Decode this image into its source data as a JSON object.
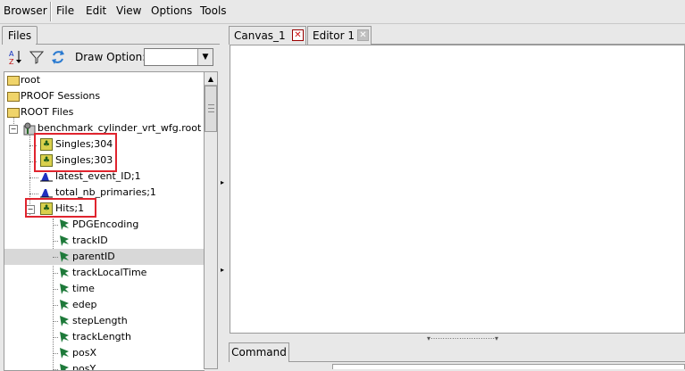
{
  "menu": {
    "browser": "Browser",
    "file": "File",
    "edit": "Edit",
    "view": "View",
    "options": "Options",
    "tools": "Tools"
  },
  "left_tab": "Files",
  "toolbar": {
    "sort_icon": "sort-az-icon",
    "filter_icon": "filter-icon",
    "refresh_icon": "refresh-icon",
    "draw_option_label": "Draw Option:",
    "draw_option_value": ""
  },
  "tree": {
    "root": "root",
    "proof": "PROOF Sessions",
    "root_files": "ROOT Files",
    "file": "benchmark_cylinder_vrt_wfg.root",
    "singles304": "Singles;304",
    "singles303": "Singles;303",
    "latest_event": "latest_event_ID;1",
    "total_nb": "total_nb_primaries;1",
    "hits": "Hits;1",
    "leaves": [
      "PDGEncoding",
      "trackID",
      "parentID",
      "trackLocalTime",
      "time",
      "edep",
      "stepLength",
      "trackLength",
      "posX",
      "posY"
    ]
  },
  "right_tabs": {
    "canvas": "Canvas_1",
    "editor": "Editor 1"
  },
  "command_tab": "Command",
  "colors": {
    "highlight_box": "#e0242e",
    "close_active": "#d01010",
    "folder": "#f0d46a"
  }
}
